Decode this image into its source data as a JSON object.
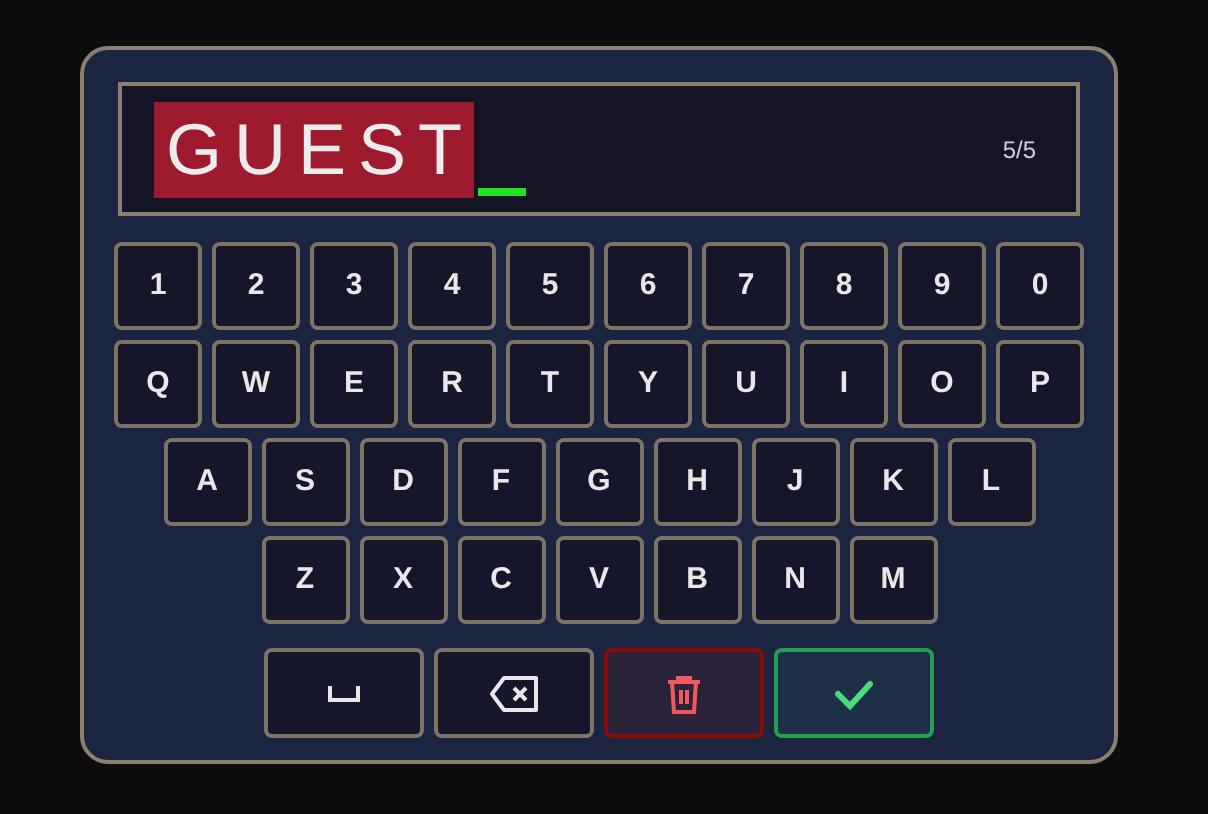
{
  "input": {
    "value": "GUEST",
    "selected": true,
    "cursor": true,
    "counter": "5/5"
  },
  "key_rows": [
    [
      "1",
      "2",
      "3",
      "4",
      "5",
      "6",
      "7",
      "8",
      "9",
      "0"
    ],
    [
      "Q",
      "W",
      "E",
      "R",
      "T",
      "Y",
      "U",
      "I",
      "O",
      "P"
    ],
    [
      "A",
      "S",
      "D",
      "F",
      "G",
      "H",
      "J",
      "K",
      "L"
    ],
    [
      "Z",
      "X",
      "C",
      "V",
      "B",
      "N",
      "M"
    ]
  ],
  "actions": [
    {
      "kind": "space"
    },
    {
      "kind": "backspace"
    },
    {
      "kind": "clear"
    },
    {
      "kind": "confirm"
    }
  ]
}
